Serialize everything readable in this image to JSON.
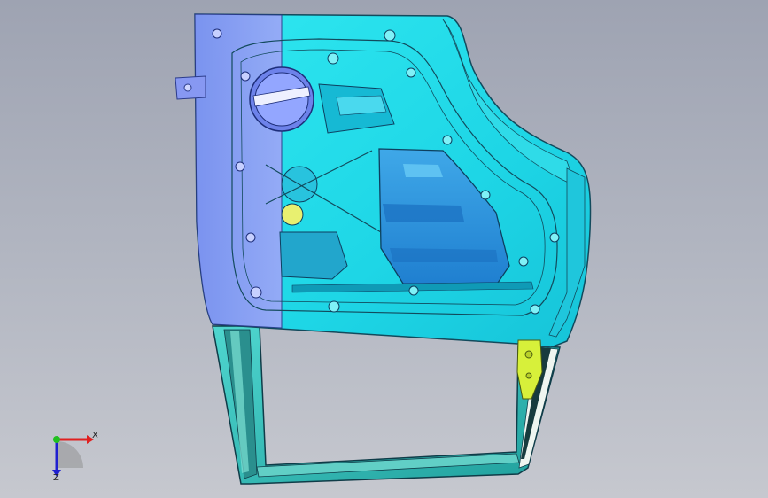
{
  "viewport": {
    "background_top": "#9ea3b2",
    "background_bottom": "#c6c8cf"
  },
  "model": {
    "part": "car-door-inner-panel",
    "colors": {
      "panel_left": "#8a9cf4",
      "panel_main": "#23e4ee",
      "panel_shadow": "#0fb7cf",
      "window_frame": "#3ec7c6",
      "bracket": "#d7f03a",
      "edge": "#124a5c"
    }
  },
  "triad": {
    "x_label": "X",
    "z_label": "Z",
    "x_color": "#e02020",
    "y_color": "#20c020",
    "z_color": "#2020d0"
  }
}
